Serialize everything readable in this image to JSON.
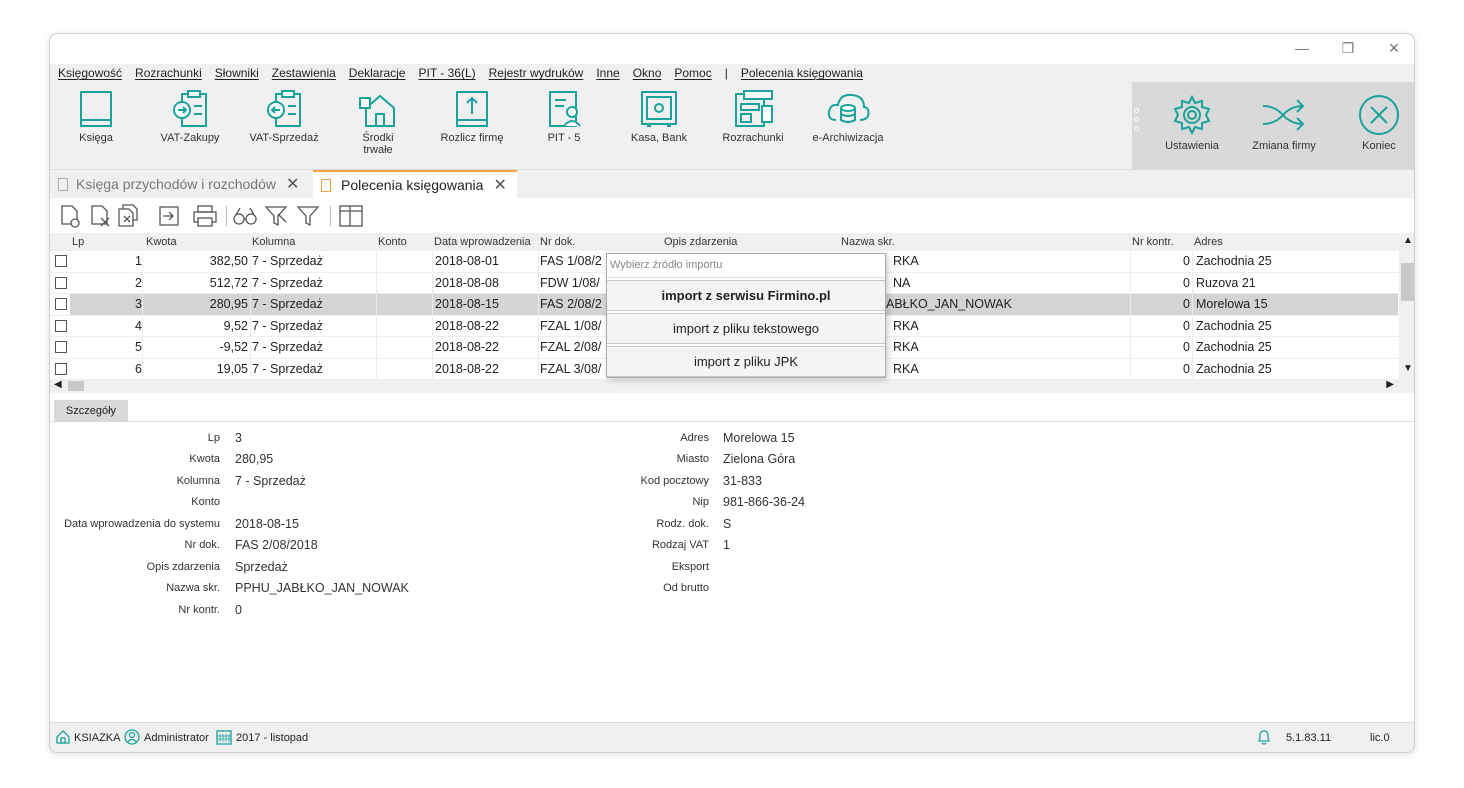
{
  "window": {
    "controls": [
      "minimize",
      "restore",
      "close"
    ]
  },
  "menu": [
    "Księgowość",
    "Rozrachunki",
    "Słowniki",
    "Zestawienia",
    "Deklaracje",
    "PIT - 36(L)",
    "Rejestr wydruków",
    "Inne",
    "Okno",
    "Pomoc",
    "|",
    "Polecenia księgowania"
  ],
  "ribbon": {
    "buttons": [
      {
        "label": "Księga",
        "icon": "book-icon"
      },
      {
        "label": "VAT-Zakupy",
        "icon": "vat-purchase-icon"
      },
      {
        "label": "VAT-Sprzedaż",
        "icon": "vat-sale-icon"
      },
      {
        "label": "Środki trwałe",
        "icon": "fixed-assets-icon"
      },
      {
        "label": "Rozlicz firmę",
        "icon": "settle-company-icon"
      },
      {
        "label": "PIT - 5",
        "icon": "pit5-icon"
      },
      {
        "label": "Kasa, Bank",
        "icon": "safe-icon"
      },
      {
        "label": "Rozrachunki",
        "icon": "settlements-icon"
      },
      {
        "label": "e-Archiwizacja",
        "icon": "cloud-archive-icon"
      }
    ],
    "right_buttons": [
      {
        "label": "Ustawienia",
        "icon": "gear-icon"
      },
      {
        "label": "Zmiana firmy",
        "icon": "shuffle-icon"
      },
      {
        "label": "Koniec",
        "icon": "close-circle-icon"
      }
    ],
    "accent": "#1aa39a"
  },
  "tabs": [
    {
      "label": "Księga przychodów i rozchodów",
      "active": false
    },
    {
      "label": "Polecenia księgowania",
      "active": true
    }
  ],
  "grid": {
    "columns": [
      "Lp",
      "Kwota",
      "Kolumna",
      "Konto",
      "Data wprowadzenia",
      "Nr dok.",
      "Opis zdarzenia",
      "Nazwa skr.",
      "Nr kontr.",
      "Adres"
    ],
    "rows": [
      {
        "lp": "1",
        "kwota": "382,50",
        "kolumna": "7 - Sprzedaż",
        "data": "2018-08-01",
        "nrdok": "FAS 1/08/2",
        "nazwa": "RKA",
        "nrkontr": "0",
        "adres": "Zachodnia 25",
        "selected": false
      },
      {
        "lp": "2",
        "kwota": "512,72",
        "kolumna": "7 - Sprzedaż",
        "data": "2018-08-08",
        "nrdok": "FDW 1/08/",
        "nazwa": "NA",
        "nrkontr": "0",
        "adres": "Ruzova 21",
        "selected": false
      },
      {
        "lp": "3",
        "kwota": "280,95",
        "kolumna": "7 - Sprzedaż",
        "data": "2018-08-15",
        "nrdok": "FAS 2/08/2",
        "nazwa": "ABŁKO_JAN_NOWAK",
        "nrkontr": "0",
        "adres": "Morelowa 15",
        "selected": true
      },
      {
        "lp": "4",
        "kwota": "9,52",
        "kolumna": "7 - Sprzedaż",
        "data": "2018-08-22",
        "nrdok": "FZAL 1/08/",
        "nazwa": "RKA",
        "nrkontr": "0",
        "adres": "Zachodnia 25",
        "selected": false
      },
      {
        "lp": "5",
        "kwota": "-9,52",
        "kolumna": "7 - Sprzedaż",
        "data": "2018-08-22",
        "nrdok": "FZAL 2/08/",
        "nazwa": "RKA",
        "nrkontr": "0",
        "adres": "Zachodnia 25",
        "selected": false
      },
      {
        "lp": "6",
        "kwota": "19,05",
        "kolumna": "7 - Sprzedaż",
        "data": "2018-08-22",
        "nrdok": "FZAL 3/08/",
        "nazwa": "RKA",
        "nrkontr": "0",
        "adres": "Zachodnia 25",
        "selected": false
      }
    ]
  },
  "popup": {
    "placeholder": "Wybierz źródło importu",
    "options": [
      "import z serwisu Firmino.pl",
      "import z pliku tekstowego",
      "import z pliku JPK"
    ]
  },
  "details": {
    "tab": "Szczegóły",
    "left": [
      {
        "label": "Lp",
        "value": "3"
      },
      {
        "label": "Kwota",
        "value": "280,95"
      },
      {
        "label": "Kolumna",
        "value": "7 - Sprzedaż"
      },
      {
        "label": "Konto",
        "value": ""
      },
      {
        "label": "Data wprowadzenia do systemu",
        "value": "2018-08-15"
      },
      {
        "label": "Nr dok.",
        "value": "FAS 2/08/2018"
      },
      {
        "label": "Opis zdarzenia",
        "value": "Sprzedaż"
      },
      {
        "label": "Nazwa skr.",
        "value": "PPHU_JABŁKO_JAN_NOWAK"
      },
      {
        "label": "Nr kontr.",
        "value": "0"
      }
    ],
    "right": [
      {
        "label": "Adres",
        "value": "Morelowa 15"
      },
      {
        "label": "Miasto",
        "value": "Zielona Góra"
      },
      {
        "label": "Kod pocztowy",
        "value": "31-833"
      },
      {
        "label": "Nip",
        "value": "981-866-36-24"
      },
      {
        "label": "Rodz. dok.",
        "value": "S"
      },
      {
        "label": "Rodzaj VAT",
        "value": "1"
      },
      {
        "label": "Eksport",
        "value": ""
      },
      {
        "label": "Od brutto",
        "value": ""
      }
    ]
  },
  "status": {
    "db": "KSIAZKA",
    "user": "Administrator",
    "period": "2017  - listopad",
    "version": "5.1.83.11",
    "lic": "lic.0"
  }
}
